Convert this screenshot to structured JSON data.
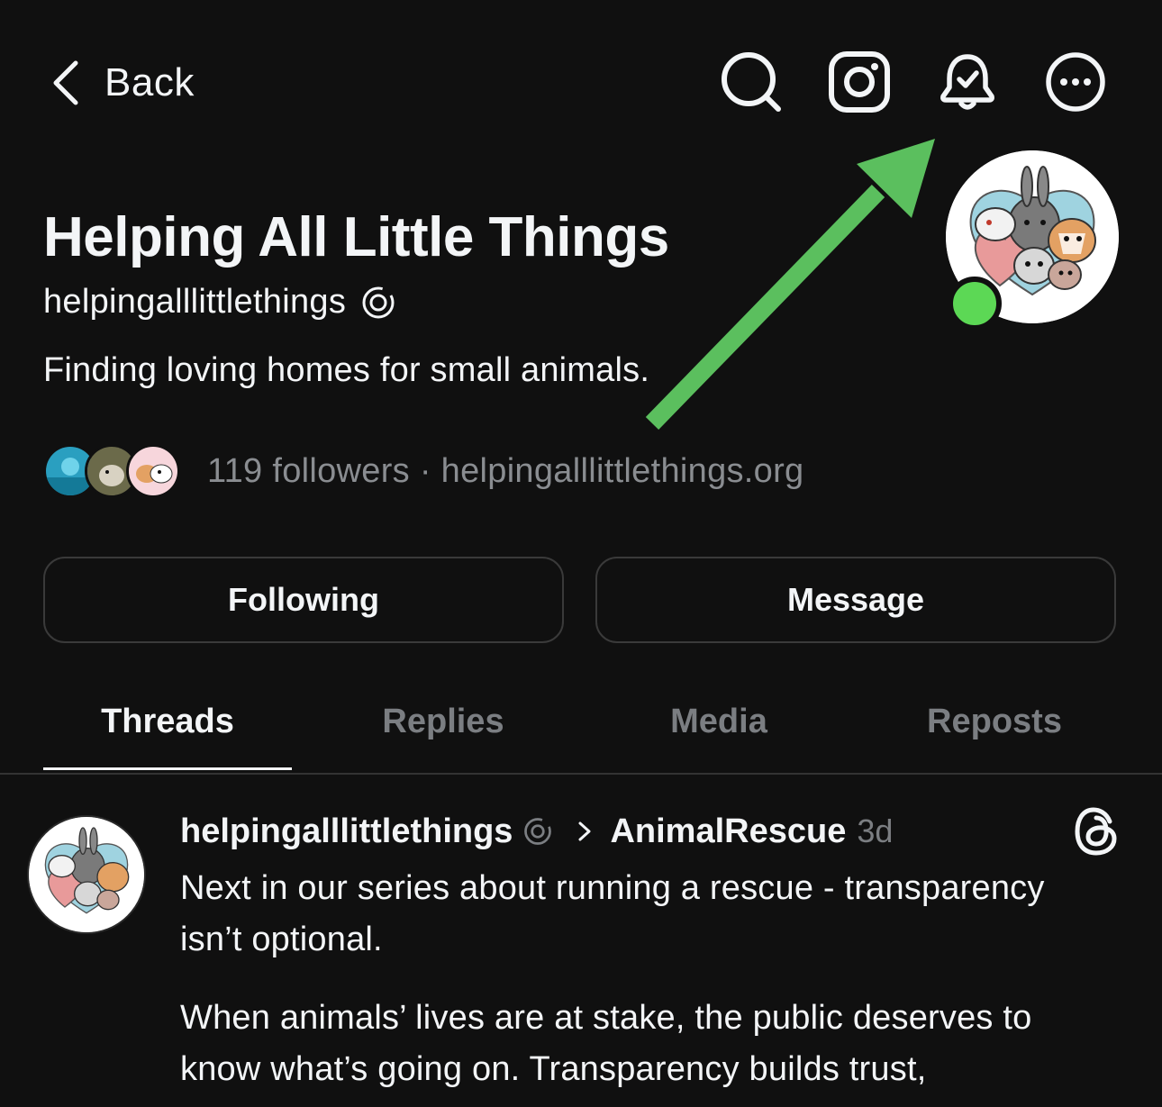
{
  "header": {
    "back_label": "Back",
    "icons": [
      "search-icon",
      "instagram-icon",
      "notification-bell-check-icon",
      "more-options-icon"
    ]
  },
  "profile": {
    "name": "Helping All Little Things",
    "handle": "helpingalllittlethings",
    "bio": "Finding loving homes for small animals.",
    "followers_text": "119 followers · helpingalllittlethings.org",
    "online": true
  },
  "buttons": {
    "following_label": "Following",
    "message_label": "Message"
  },
  "tabs": [
    {
      "label": "Threads",
      "active": true
    },
    {
      "label": "Replies",
      "active": false
    },
    {
      "label": "Media",
      "active": false
    },
    {
      "label": "Reposts",
      "active": false
    }
  ],
  "post": {
    "username": "helpingalllittlethings",
    "topic": "AnimalRescue",
    "time": "3d",
    "paragraph1_line1": "Next in our series about running a rescue -  transparency",
    "paragraph1_line2": "isn’t optional.",
    "paragraph2_line1": "When animals’ lives are at stake, the public deserves to",
    "paragraph2_line2": "know what’s going on. Transparency builds trust,"
  },
  "colors": {
    "background": "#101010",
    "text": "#f3f5f7",
    "muted": "#7b7e82",
    "online_dot": "#5cd855",
    "annotation_arrow": "#5bbf5e"
  }
}
